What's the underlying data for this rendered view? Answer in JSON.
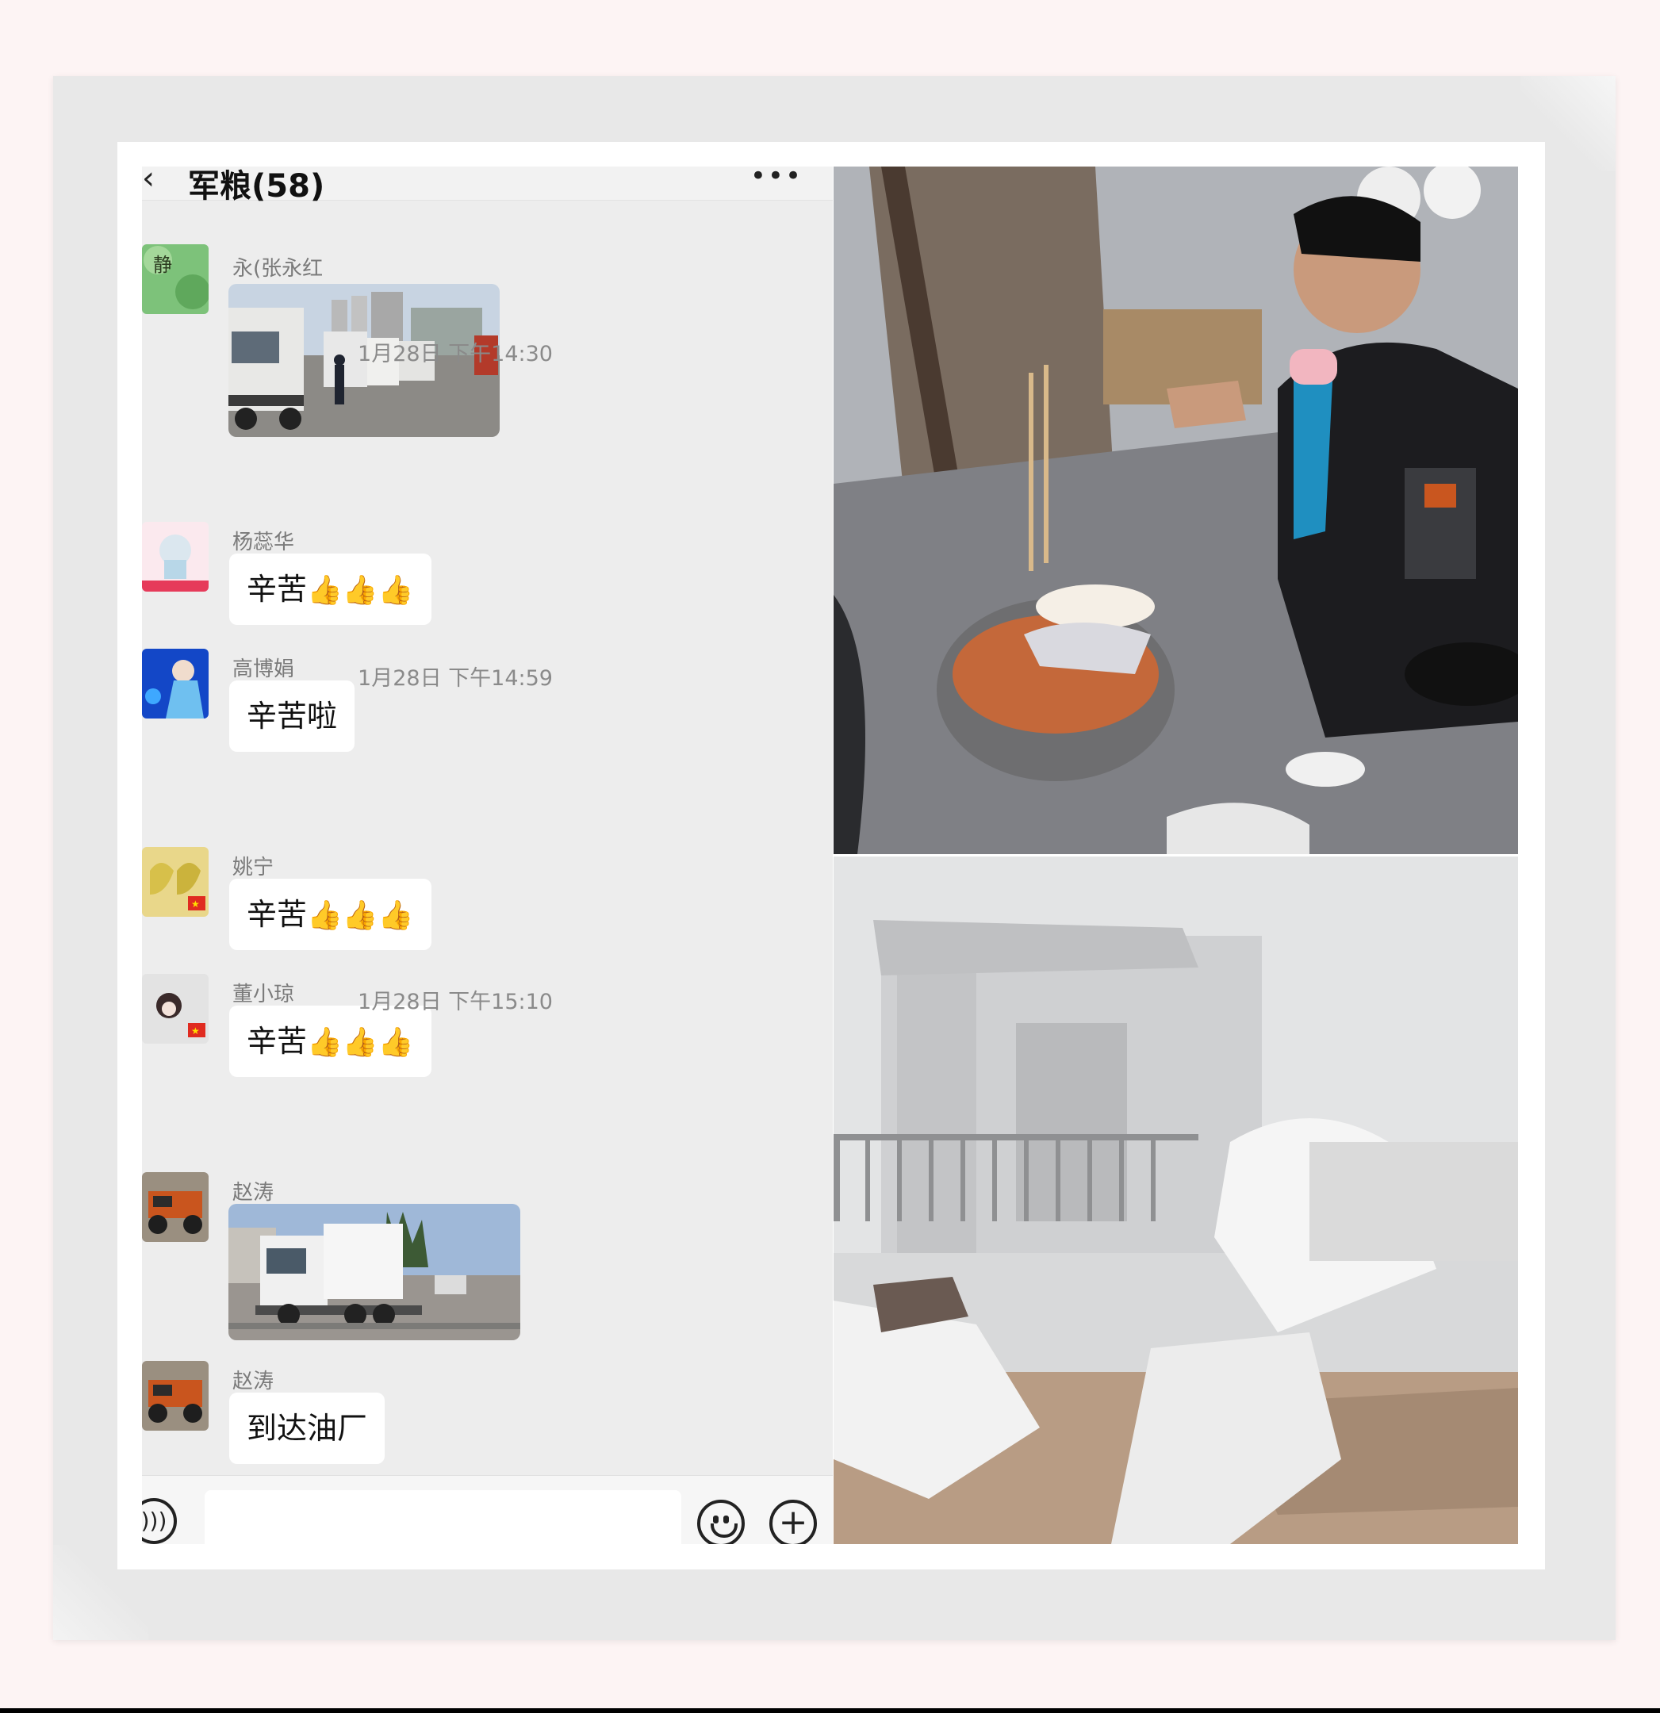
{
  "chat": {
    "title": "军粮(58)",
    "back_icon": "chevron-left-icon",
    "more_icon": "more-dots-icon",
    "timestamps": [
      "1月28日 下午14:30",
      "1月28日 下午14:59",
      "1月28日 下午15:10"
    ],
    "messages": [
      {
        "sender": "永(张永红",
        "type": "image",
        "image": "trucks-at-depot-photo"
      },
      {
        "sender": "杨蕊华",
        "type": "text",
        "text": "辛苦",
        "emoji": "👍👍👍"
      },
      {
        "sender": "高博娟",
        "type": "text",
        "text": "辛苦啦"
      },
      {
        "sender": "姚宁",
        "type": "text",
        "text": "辛苦",
        "emoji": "👍👍👍"
      },
      {
        "sender": "董小琼",
        "type": "text",
        "text": "辛苦",
        "emoji": "👍👍👍"
      },
      {
        "sender": "赵涛",
        "type": "image",
        "image": "truck-on-weighbridge-photo"
      },
      {
        "sender": "赵涛",
        "type": "text",
        "text": "到达油厂"
      }
    ],
    "input": {
      "placeholder": "",
      "voice_icon": "voice-icon",
      "emoji_icon": "emoji-icon",
      "plus_icon": "plus-circle-icon"
    }
  },
  "photos": [
    {
      "name": "man-eating-noodles-photo"
    },
    {
      "name": "bedding-on-floor-photo"
    }
  ]
}
